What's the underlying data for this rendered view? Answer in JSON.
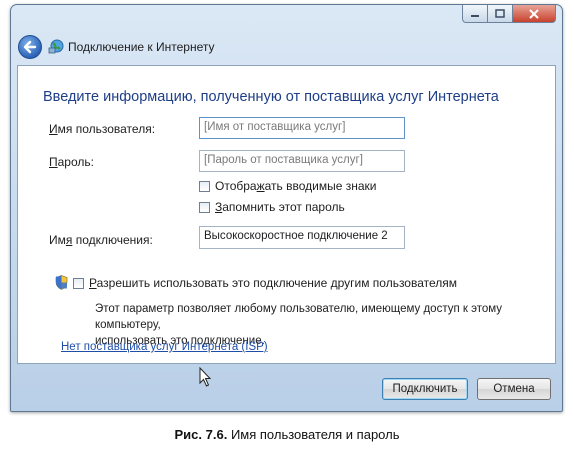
{
  "window": {
    "title": "Подключение к Интернету"
  },
  "heading": "Введите информацию, полученную от поставщика услуг Интернета",
  "username": {
    "label_pre": "",
    "label_u": "И",
    "label_post": "мя пользователя:",
    "placeholder": "[Имя от поставщика услуг]"
  },
  "password": {
    "label_pre": "",
    "label_u": "П",
    "label_post": "ароль:",
    "placeholder": "[Пароль от поставщика услуг]"
  },
  "show_chars": {
    "label_pre": "Отобра",
    "label_u": "ж",
    "label_post": "ать вводимые знаки",
    "checked": false
  },
  "remember": {
    "label_pre": "",
    "label_u": "З",
    "label_post": "апомнить этот пароль",
    "checked": false
  },
  "connection_name": {
    "label_pre": "Им",
    "label_u": "я",
    "label_post": " подключения:",
    "value": "Высокоскоростное подключение 2"
  },
  "allow_others": {
    "label_pre": "",
    "label_u": "Р",
    "label_post": "азрешить использовать это подключение другим пользователям",
    "checked": false,
    "note_line1": "Этот параметр позволяет любому пользователю, имеющему доступ к этому компьютеру,",
    "note_line2": "использовать это подключение."
  },
  "isp_link": "Нет поставщика услуг Интернета (ISP)",
  "buttons": {
    "connect": "Подключить",
    "cancel": "Отмена"
  },
  "figure_caption": {
    "number": "Рис. 7.6.",
    "text": " Имя пользователя и пароль"
  },
  "colors": {
    "heading": "#1e3e87",
    "link": "#1f4ea8",
    "frame": "#c7daee"
  }
}
